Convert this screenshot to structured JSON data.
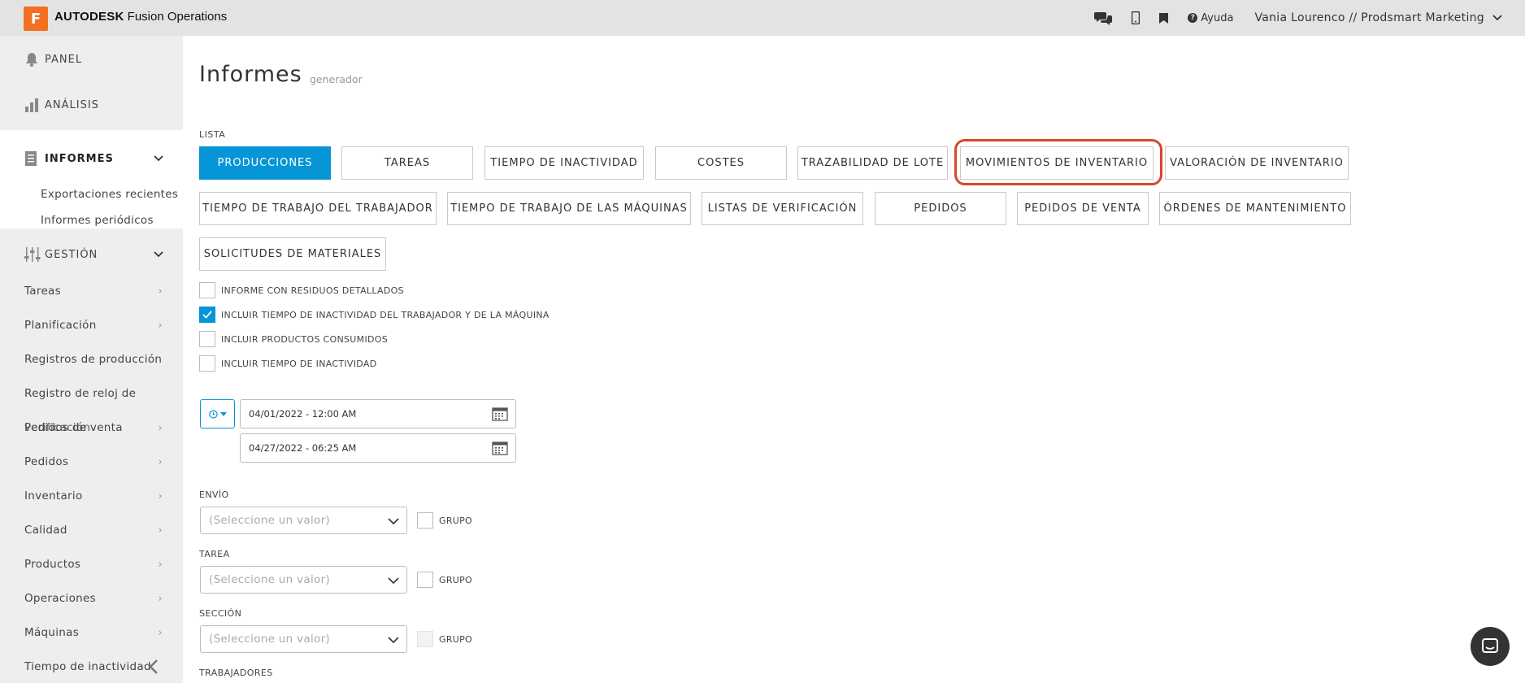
{
  "topbar": {
    "logo_letter": "F",
    "brand_bold": "AUTODESK",
    "brand_rest": " Fusion Operations",
    "help_label": "Ayuda",
    "user_label": "Vania Lourenco // Prodsmart Marketing"
  },
  "sidebar": {
    "sections": {
      "panel": "PANEL",
      "analisis": "ANÁLISIS",
      "informes": "INFORMES",
      "gestion": "GESTIÓN"
    },
    "informes_sub": [
      "Exportaciones recientes",
      "Informes periódicos"
    ],
    "gestion_items": [
      "Tareas",
      "Planificación",
      "Registros de producción",
      "Registro de reloj de",
      "Pedidos de venta",
      "Pedidos",
      "Inventario",
      "Calidad",
      "Productos",
      "Operaciones",
      "Máquinas",
      "Tiempo de inactividad"
    ],
    "overlap_text": "verificación"
  },
  "main": {
    "title": "Informes",
    "subtitle": "generador",
    "lista_label": "LISTA",
    "report_buttons": [
      "PRODUCCIONES",
      "TAREAS",
      "TIEMPO DE INACTIVIDAD",
      "COSTES",
      "TRAZABILIDAD DE LOTE",
      "MOVIMIENTOS DE INVENTARIO",
      "VALORACIÓN DE INVENTARIO",
      "TIEMPO DE TRABAJO DEL TRABAJADOR",
      "TIEMPO DE TRABAJO DE LAS MÁQUINAS",
      "LISTAS DE VERIFICACIÓN",
      "PEDIDOS",
      "PEDIDOS DE VENTA",
      "ÓRDENES DE MANTENIMIENTO",
      "SOLICITUDES DE MATERIALES"
    ],
    "options": [
      {
        "label": "INFORME CON RESIDUOS DETALLADOS",
        "checked": false
      },
      {
        "label": "INCLUIR TIEMPO DE INACTIVIDAD DEL TRABAJADOR Y DE LA MÁQUINA",
        "checked": true
      },
      {
        "label": "INCLUIR PRODUCTOS CONSUMIDOS",
        "checked": false
      },
      {
        "label": "INCLUIR TIEMPO DE INACTIVIDAD",
        "checked": false
      }
    ],
    "date_from": "04/01/2022 - 12:00 AM",
    "date_to": "04/27/2022 - 06:25 AM",
    "filters": [
      {
        "label": "ENVÍO",
        "placeholder": "(Seleccione un valor)",
        "group_label": "GRUPO"
      },
      {
        "label": "TAREA",
        "placeholder": "(Seleccione un valor)",
        "group_label": "GRUPO"
      },
      {
        "label": "SECCIÓN",
        "placeholder": "(Seleccione un valor)",
        "group_label": "GRUPO"
      }
    ],
    "trabajadores_label": "TRABAJADORES"
  },
  "colors": {
    "primary": "#0696d7",
    "highlight": "#d9472b",
    "brand_orange": "#f37021"
  }
}
